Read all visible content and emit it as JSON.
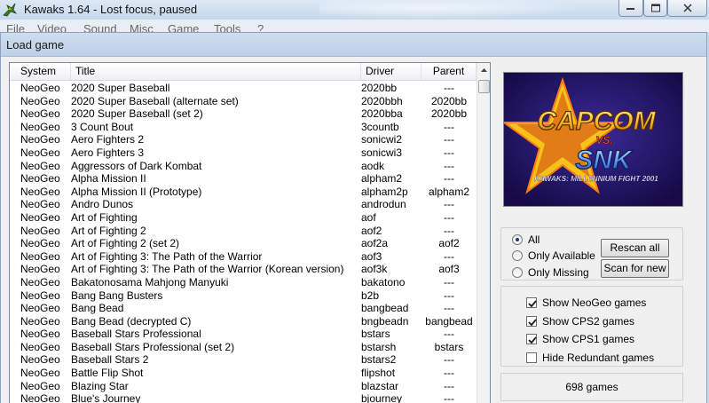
{
  "window": {
    "title": "Kawaks 1.64 - Lost focus, paused"
  },
  "menu": [
    "File",
    "Video",
    "Sound",
    "Misc",
    "Game",
    "Tools",
    "?"
  ],
  "dialog": {
    "title": "Load game"
  },
  "list": {
    "columns": [
      "System",
      "Title",
      "Driver",
      "Parent"
    ],
    "rows": [
      [
        "NeoGeo",
        "2020 Super Baseball",
        "2020bb",
        "---"
      ],
      [
        "NeoGeo",
        "2020 Super Baseball (alternate set)",
        "2020bbh",
        "2020bb"
      ],
      [
        "NeoGeo",
        "2020 Super Baseball (set 2)",
        "2020bba",
        "2020bb"
      ],
      [
        "NeoGeo",
        "3 Count Bout",
        "3countb",
        "---"
      ],
      [
        "NeoGeo",
        "Aero Fighters 2",
        "sonicwi2",
        "---"
      ],
      [
        "NeoGeo",
        "Aero Fighters 3",
        "sonicwi3",
        "---"
      ],
      [
        "NeoGeo",
        "Aggressors of Dark Kombat",
        "aodk",
        "---"
      ],
      [
        "NeoGeo",
        "Alpha Mission II",
        "alpham2",
        "---"
      ],
      [
        "NeoGeo",
        "Alpha Mission II (Prototype)",
        "alpham2p",
        "alpham2"
      ],
      [
        "NeoGeo",
        "Andro Dunos",
        "androdun",
        "---"
      ],
      [
        "NeoGeo",
        "Art of Fighting",
        "aof",
        "---"
      ],
      [
        "NeoGeo",
        "Art of Fighting 2",
        "aof2",
        "---"
      ],
      [
        "NeoGeo",
        "Art of Fighting 2 (set 2)",
        "aof2a",
        "aof2"
      ],
      [
        "NeoGeo",
        "Art of Fighting 3: The Path of the Warrior",
        "aof3",
        "---"
      ],
      [
        "NeoGeo",
        "Art of Fighting 3: The Path of the Warrior (Korean version)",
        "aof3k",
        "aof3"
      ],
      [
        "NeoGeo",
        "Bakatonosama Mahjong Manyuki",
        "bakatono",
        "---"
      ],
      [
        "NeoGeo",
        "Bang Bang Busters",
        "b2b",
        "---"
      ],
      [
        "NeoGeo",
        "Bang Bead",
        "bangbead",
        "---"
      ],
      [
        "NeoGeo",
        "Bang Bead (decrypted C)",
        "bngbeadn",
        "bangbead"
      ],
      [
        "NeoGeo",
        "Baseball Stars Professional",
        "bstars",
        "---"
      ],
      [
        "NeoGeo",
        "Baseball Stars Professional (set 2)",
        "bstarsh",
        "bstars"
      ],
      [
        "NeoGeo",
        "Baseball Stars 2",
        "bstars2",
        "---"
      ],
      [
        "NeoGeo",
        "Battle Flip Shot",
        "flipshot",
        "---"
      ],
      [
        "NeoGeo",
        "Blazing Star",
        "blazstar",
        "---"
      ],
      [
        "NeoGeo",
        "Blue's Journey",
        "bjourney",
        "---"
      ]
    ]
  },
  "preview": {
    "logo_top": "CAPCOM",
    "logo_vs": "VS.",
    "logo_bottom": "SNK",
    "logo_sub": "KAWAKS: MILLENNIUM FIGHT 2001",
    "bg_color": "#1e1060",
    "star_color": "#f6c21c"
  },
  "filter": {
    "options": [
      "All",
      "Only Available",
      "Only Missing"
    ],
    "selected": "All",
    "rescan_label": "Rescan all",
    "scan_new_label": "Scan for new"
  },
  "checks": [
    {
      "label": "Show NeoGeo games",
      "checked": true
    },
    {
      "label": "Show CPS2 games",
      "checked": true
    },
    {
      "label": "Show CPS1 games",
      "checked": true
    },
    {
      "label": "Hide Redundant games",
      "checked": false
    }
  ],
  "count_label": "698 games"
}
